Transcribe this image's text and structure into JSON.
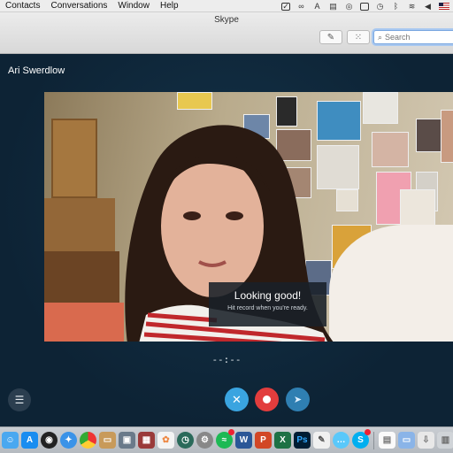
{
  "menubar": {
    "items": [
      "Contacts",
      "Conversations",
      "Window",
      "Help"
    ]
  },
  "window": {
    "title": "Skype"
  },
  "toolbar": {
    "search_placeholder": "Search"
  },
  "call": {
    "caller_name": "Ari Swerdlow",
    "toast_title": "Looking good!",
    "toast_subtitle": "Hit record when you're ready.",
    "timer": "--:--"
  },
  "colors": {
    "accent_blue": "#3aa4e0",
    "record_red": "#e23d3d",
    "background": "#0d2335"
  },
  "dock": {
    "apps": [
      "finder-icon",
      "app-store-icon",
      "dashboard-icon",
      "safari-icon",
      "chrome-icon",
      "preview-icon",
      "photo-booth-icon",
      "mission-control-icon",
      "photos-icon",
      "time-machine-icon",
      "system-preferences-icon",
      "spotify-icon",
      "word-icon",
      "powerpoint-icon",
      "excel-icon",
      "photoshop-icon",
      "textedit-icon",
      "messages-icon",
      "skype-icon",
      "document-icon",
      "folder-icon",
      "downloads-icon",
      "trash-icon"
    ]
  }
}
